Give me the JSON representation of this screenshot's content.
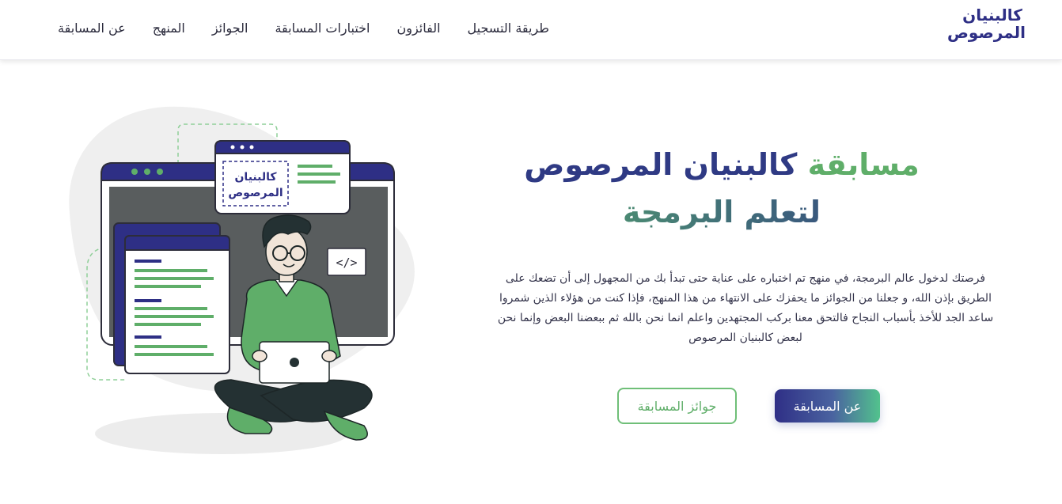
{
  "logo": {
    "line1": "كالبنيان",
    "line2": "المرصوص"
  },
  "nav": {
    "items": [
      {
        "label": "عن المسابقة"
      },
      {
        "label": "المنهج"
      },
      {
        "label": "الجوائز"
      },
      {
        "label": "اختبارات المسابقة"
      },
      {
        "label": "الفائزون"
      },
      {
        "label": "طريقة التسجيل"
      }
    ]
  },
  "hero": {
    "title_part1": "مسابقة",
    "title_part2": "كالبنيان المرصوص",
    "title_line2": "لتعلم البرمجة",
    "description": "فرصتك لدخول عالم البرمجة، في منهج تم اختباره على عناية حتى تبدأ بك من المجهول إلى أن تضعك على الطريق بإذن الله، و جعلنا من الجوائز ما يحفزك على الانتهاء من هذا المنهج، فإذا كنت من هؤلاء الذين شمروا ساعد الجد للأخذ بأسباب النجاح فالتحق معنا بركب المجتهدين واعلم انما نحن بالله ثم ببعضنا البعض وإنما نحن لبعض كالبنيان المرصوص",
    "primary_button": "عن المسابقة",
    "secondary_button": "جوائز المسابقة"
  },
  "illustration": {
    "code_tag": "</>",
    "badge_line1": "كالبنيان",
    "badge_line2": "المرصوص"
  },
  "colors": {
    "navy": "#2f2f86",
    "green": "#5fae69",
    "screen_gray": "#595d5e"
  }
}
